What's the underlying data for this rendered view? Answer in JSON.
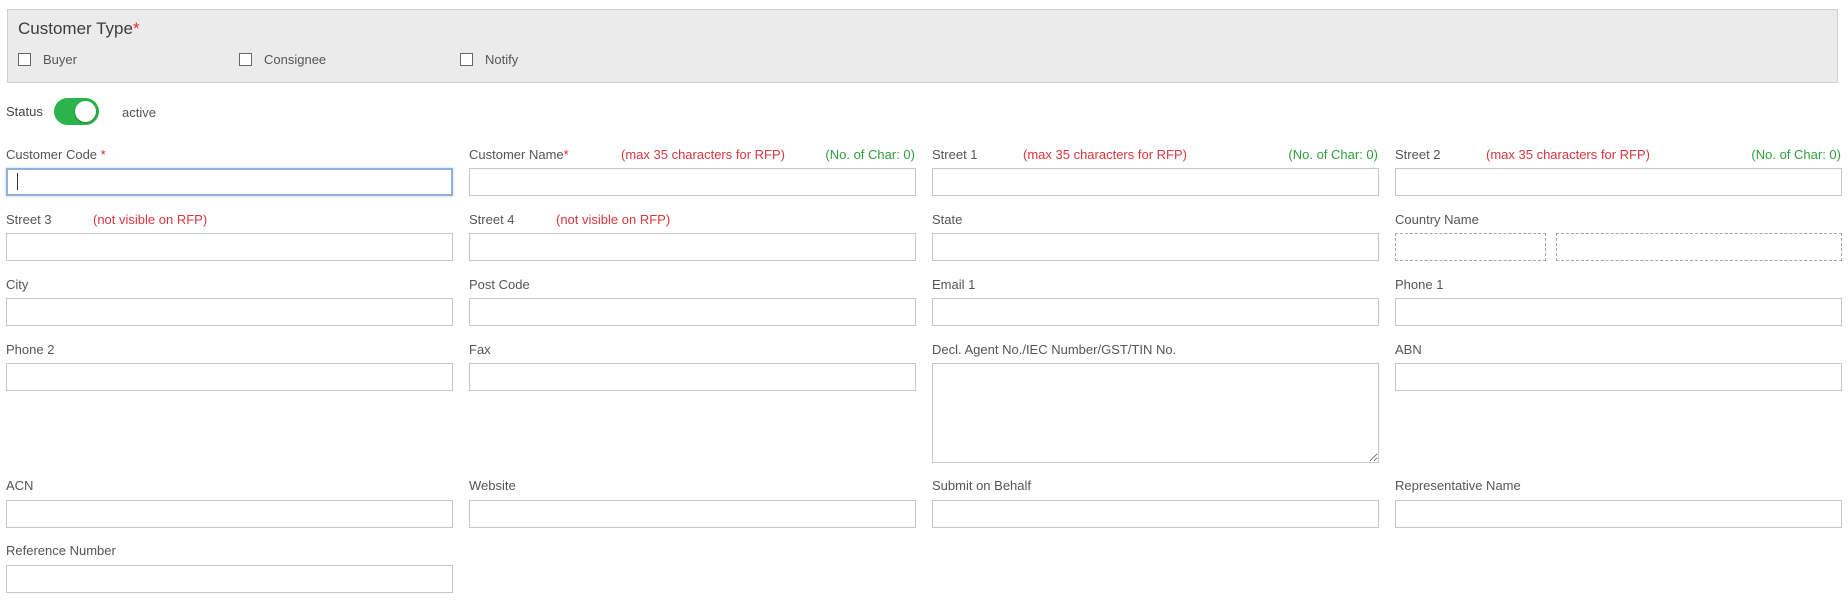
{
  "customer_type": {
    "title": "Customer Type",
    "required_mark": "*",
    "options": [
      {
        "label": "Buyer",
        "checked": false
      },
      {
        "label": "Consignee",
        "checked": false
      },
      {
        "label": "Notify",
        "checked": false
      }
    ]
  },
  "status": {
    "label": "Status",
    "value": "active",
    "on": true,
    "accent": "#2ab44a"
  },
  "notes": {
    "max35": "(max 35 characters for RFP)",
    "char_count": "(No. of Char: 0)",
    "not_visible": "(not visible on RFP)"
  },
  "fields": {
    "customer_code": {
      "label": "Customer Code ",
      "required_mark": "*",
      "value": ""
    },
    "customer_name": {
      "label": "Customer Name",
      "required_mark": "*",
      "value": ""
    },
    "street1": {
      "label": "Street 1",
      "value": ""
    },
    "street2": {
      "label": "Street 2",
      "value": ""
    },
    "street3": {
      "label": "Street 3",
      "value": ""
    },
    "street4": {
      "label": "Street 4",
      "value": ""
    },
    "state": {
      "label": "State",
      "value": ""
    },
    "country_name": {
      "label": "Country Name",
      "value": ""
    },
    "city": {
      "label": "City",
      "value": ""
    },
    "post_code": {
      "label": "Post Code",
      "value": ""
    },
    "email1": {
      "label": "Email 1",
      "value": ""
    },
    "phone1": {
      "label": "Phone 1",
      "value": ""
    },
    "phone2": {
      "label": "Phone 2",
      "value": ""
    },
    "fax": {
      "label": "Fax",
      "value": ""
    },
    "decl_agent": {
      "label": "Decl. Agent No./IEC Number/GST/TIN No.",
      "value": ""
    },
    "abn": {
      "label": "ABN",
      "value": ""
    },
    "acn": {
      "label": "ACN",
      "value": ""
    },
    "website": {
      "label": "Website",
      "value": ""
    },
    "submit_on_behalf": {
      "label": "Submit on Behalf",
      "value": ""
    },
    "representative_name": {
      "label": "Representative Name",
      "value": ""
    },
    "reference_number": {
      "label": "Reference Number",
      "value": ""
    }
  }
}
